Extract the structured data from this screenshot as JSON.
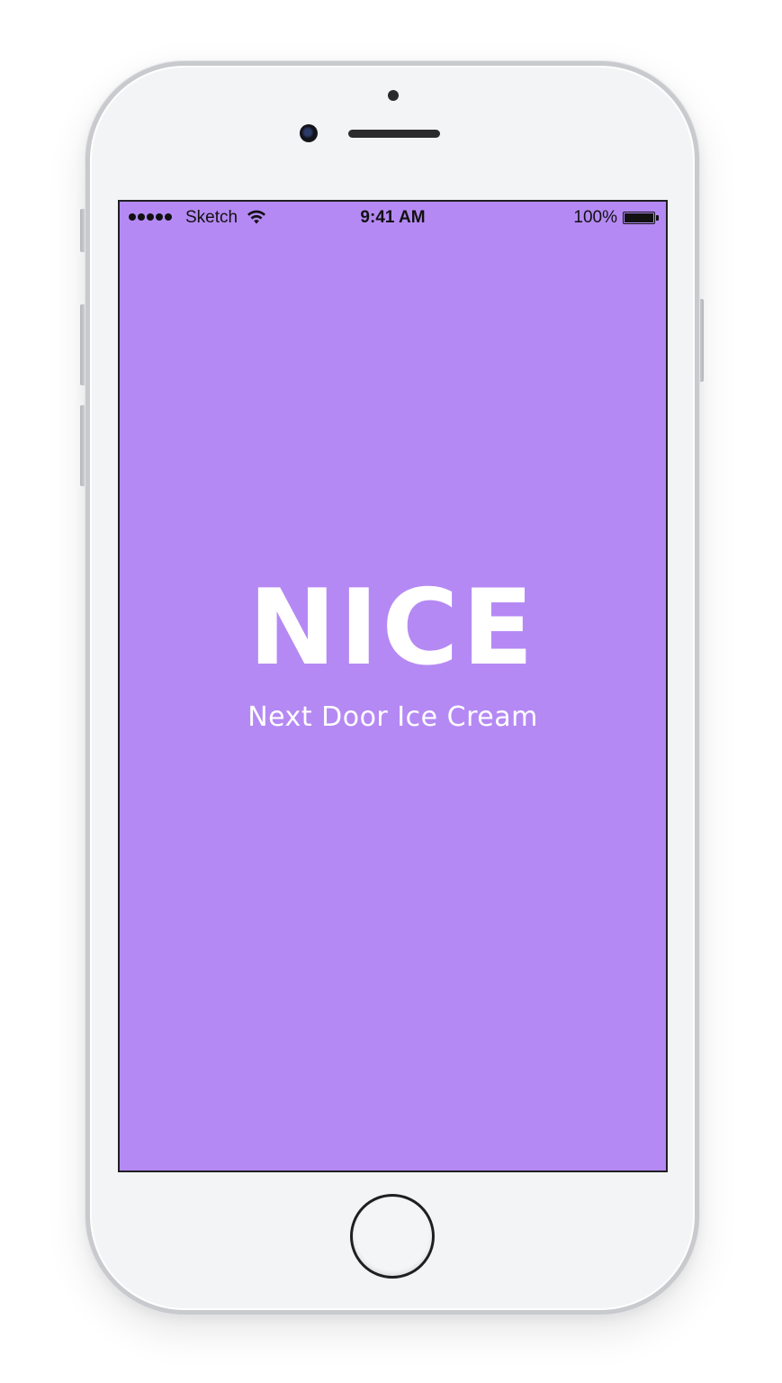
{
  "status_bar": {
    "carrier": "Sketch",
    "time": "9:41 AM",
    "battery_percent": "100%",
    "signal_icon": "signal-dots-icon",
    "wifi_icon": "wifi-icon",
    "battery_icon": "battery-full-icon"
  },
  "splash": {
    "logo_text": "NICE",
    "tagline": "Next Door Ice Cream",
    "background_color": "#b589f4",
    "text_color": "#ffffff"
  },
  "device": {
    "home_button_icon": "home-button-icon",
    "camera_icon": "front-camera-icon",
    "speaker_icon": "earpiece-speaker-icon"
  }
}
